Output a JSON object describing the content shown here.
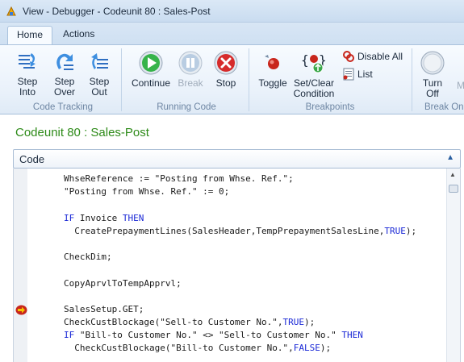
{
  "window": {
    "title": "View - Debugger - Codeunit 80 : Sales-Post"
  },
  "tabs": [
    {
      "label": "Home",
      "active": true
    },
    {
      "label": "Actions",
      "active": false
    }
  ],
  "ribbon": {
    "groups": {
      "code_tracking": "Code Tracking",
      "running_code": "Running Code",
      "breakpoints": "Breakpoints",
      "break_on": "Break On"
    },
    "buttons": {
      "step_into": "Step Into",
      "step_over": "Step Over",
      "step_out": "Step Out",
      "continue": "Continue",
      "break": "Break",
      "stop": "Stop",
      "toggle": "Toggle",
      "set_clear_condition": "Set/Clear Condition",
      "disable_all": "Disable All",
      "list": "List",
      "turn_off": "Turn Off",
      "next_cut": "M"
    }
  },
  "page_title": "Codeunit 80 : Sales-Post",
  "code_panel": {
    "header": "Code",
    "current_line_index": 9,
    "lines": [
      [
        {
          "t": "WhseReference := \"Posting from Whse. Ref.\";",
          "k": false
        }
      ],
      [
        {
          "t": "\"Posting from Whse. Ref.\" := 0;",
          "k": false
        }
      ],
      [
        {
          "t": "",
          "k": false
        }
      ],
      [
        {
          "t": "IF",
          "k": true
        },
        {
          "t": " Invoice ",
          "k": false
        },
        {
          "t": "THEN",
          "k": true
        }
      ],
      [
        {
          "t": "  CreatePrepaymentLines(SalesHeader,TempPrepaymentSalesLine,",
          "k": false
        },
        {
          "t": "TRUE",
          "k": true
        },
        {
          "t": ");",
          "k": false
        }
      ],
      [
        {
          "t": "",
          "k": false
        }
      ],
      [
        {
          "t": "CheckDim;",
          "k": false
        }
      ],
      [
        {
          "t": "",
          "k": false
        }
      ],
      [
        {
          "t": "CopyAprvlToTempApprvl;",
          "k": false
        }
      ],
      [
        {
          "t": "",
          "k": false
        }
      ],
      [
        {
          "t": "SalesSetup.GET;",
          "k": false
        }
      ],
      [
        {
          "t": "CheckCustBlockage(\"Sell-to Customer No.\",",
          "k": false
        },
        {
          "t": "TRUE",
          "k": true
        },
        {
          "t": ");",
          "k": false
        }
      ],
      [
        {
          "t": "IF",
          "k": true
        },
        {
          "t": " \"Bill-to Customer No.\" <> \"Sell-to Customer No.\" ",
          "k": false
        },
        {
          "t": "THEN",
          "k": true
        }
      ],
      [
        {
          "t": "  CheckCustBlockage(\"Bill-to Customer No.\",",
          "k": false
        },
        {
          "t": "FALSE",
          "k": true
        },
        {
          "t": ");",
          "k": false
        }
      ]
    ]
  },
  "colors": {
    "keyword": "#1a28d6",
    "page_title": "#2e8b19",
    "group_label": "#6e86a3"
  }
}
